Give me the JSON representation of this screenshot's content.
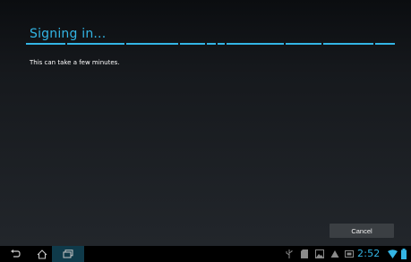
{
  "dialog": {
    "title": "Signing in...",
    "message": "This can take a few minutes.",
    "cancel_label": "Cancel"
  },
  "status_bar": {
    "time": "2:52",
    "icons": [
      "usb-icon",
      "sd-card-icon",
      "image-icon",
      "warning-icon",
      "screenshot-icon",
      "wifi-icon",
      "battery-icon"
    ]
  },
  "nav_bar": {
    "buttons": [
      "back-icon",
      "home-icon",
      "recent-apps-icon"
    ]
  },
  "colors": {
    "accent": "#33b5e5",
    "background": "#1c1f22",
    "button": "#3b3f43"
  }
}
